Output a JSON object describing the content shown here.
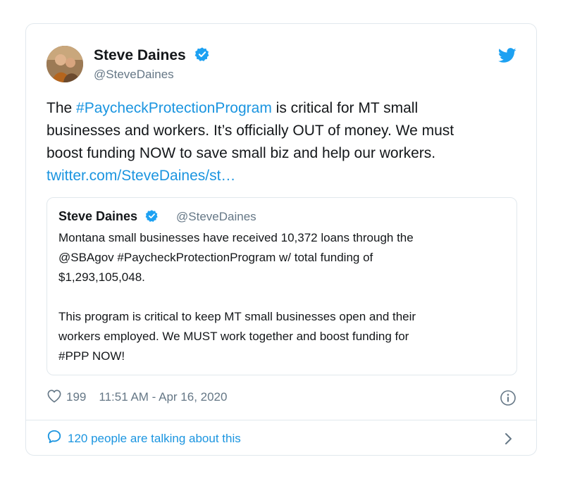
{
  "author": {
    "name": "Steve Daines",
    "handle": "@SteveDaines"
  },
  "tweet": {
    "lines": [
      [
        "The ",
        "#PaycheckProtectionProgram",
        " is critical for MT small"
      ],
      "businesses and workers. It’s officially OUT of money. We must",
      "boost funding NOW to save small biz and help our workers.",
      "twitter.com/SteveDaines/st…"
    ],
    "line1_prefix": "The ",
    "line1_hashtag": "#PaycheckProtectionProgram",
    "line1_suffix": " is critical for MT small",
    "line2": "businesses and workers. It’s officially OUT of money. We must",
    "line3": "boost funding NOW to save small biz and help our workers.",
    "link": "twitter.com/SteveDaines/st…"
  },
  "quote": {
    "name": "Steve Daines",
    "handle": "@SteveDaines",
    "line1": "Montana small businesses have received 10,372 loans through the",
    "line2": "@SBAgov #PaycheckProtectionProgram w/ total funding of",
    "line3": "$1,293,105,048.",
    "line4": "This program is critical to keep MT small businesses open and their",
    "line5": "workers employed. We MUST work together and boost funding for",
    "line6": "#PPP NOW!"
  },
  "meta": {
    "likes": "199",
    "timestamp": "11:51 AM - Apr 16, 2020"
  },
  "footer": {
    "talking": "120 people are talking about this"
  },
  "colors": {
    "link": "#1b95e0",
    "verified": "#1da1f2",
    "text": "#14171a",
    "secondary": "#657786",
    "border": "#e1e8ed"
  },
  "icons": [
    "twitter-bird-icon",
    "verified-badge-icon",
    "heart-icon",
    "info-icon",
    "speech-bubble-icon",
    "chevron-right-icon"
  ]
}
